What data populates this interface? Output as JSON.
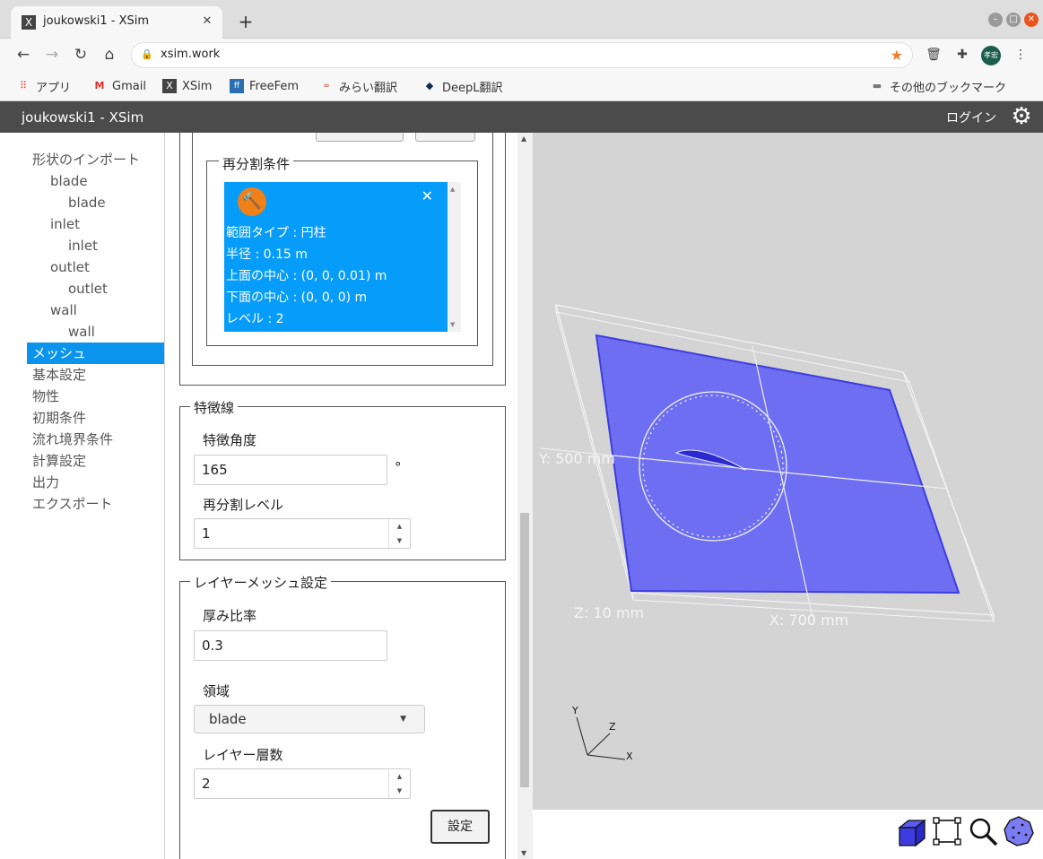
{
  "browser": {
    "tab_title": "joukowski1 - XSim",
    "favicon_letter": "X",
    "url": "xsim.work",
    "avatar_text": "孝宏",
    "bookmarks": [
      {
        "label": "アプリ",
        "icon": "apps-grid-icon"
      },
      {
        "label": "Gmail",
        "icon": "gmail-icon"
      },
      {
        "label": "XSim",
        "icon": "xsim-icon"
      },
      {
        "label": "FreeFem",
        "icon": "freefem-icon"
      },
      {
        "label": "みらい翻訳",
        "icon": "mirai-icon"
      },
      {
        "label": "DeepL翻訳",
        "icon": "deepl-icon"
      }
    ],
    "other_bookmarks": "その他のブックマーク"
  },
  "app": {
    "title": "joukowski1 - XSim",
    "login": "ログイン"
  },
  "tree": [
    {
      "label": "形状のインポート",
      "level": 0
    },
    {
      "label": "blade",
      "level": 1
    },
    {
      "label": "blade",
      "level": 2
    },
    {
      "label": "inlet",
      "level": 1
    },
    {
      "label": "inlet",
      "level": 2
    },
    {
      "label": "outlet",
      "level": 1
    },
    {
      "label": "outlet",
      "level": 2
    },
    {
      "label": "wall",
      "level": 1
    },
    {
      "label": "wall",
      "level": 2
    },
    {
      "label": "メッシュ",
      "level": 0,
      "active": true
    },
    {
      "label": "基本設定",
      "level": 0
    },
    {
      "label": "物性",
      "level": 0
    },
    {
      "label": "初期条件",
      "level": 0
    },
    {
      "label": "流れ境界条件",
      "level": 0
    },
    {
      "label": "計算設定",
      "level": 0
    },
    {
      "label": "出力",
      "level": 0
    },
    {
      "label": "エクスポート",
      "level": 0
    }
  ],
  "refine": {
    "legend": "再分割条件",
    "info_lines": [
      "範囲タイプ : 円柱",
      "半径 : 0.15 m",
      "上面の中心 : (0, 0, 0.01) m",
      "下面の中心 : (0, 0, 0) m",
      "レベル : 2"
    ]
  },
  "feature": {
    "legend": "特徴線",
    "angle_label": "特徴角度",
    "angle_value": "165",
    "angle_unit": "°",
    "level_label": "再分割レベル",
    "level_value": "1"
  },
  "layer": {
    "legend": "レイヤーメッシュ設定",
    "ratio_label": "厚み比率",
    "ratio_value": "0.3",
    "region_label": "領域",
    "region_value": "blade",
    "count_label": "レイヤー層数",
    "count_value": "2",
    "set_button": "設定"
  },
  "viewport": {
    "y_dim": "Y: 500 mm",
    "z_dim": "Z: 10 mm",
    "x_dim": "X: 700 mm",
    "axis_x": "X",
    "axis_y": "Y",
    "axis_z": "Z"
  },
  "colors": {
    "accent": "#0a94ee",
    "header": "#4b4b4b",
    "plane": "#6e6ef2",
    "badge": "#f08018"
  }
}
